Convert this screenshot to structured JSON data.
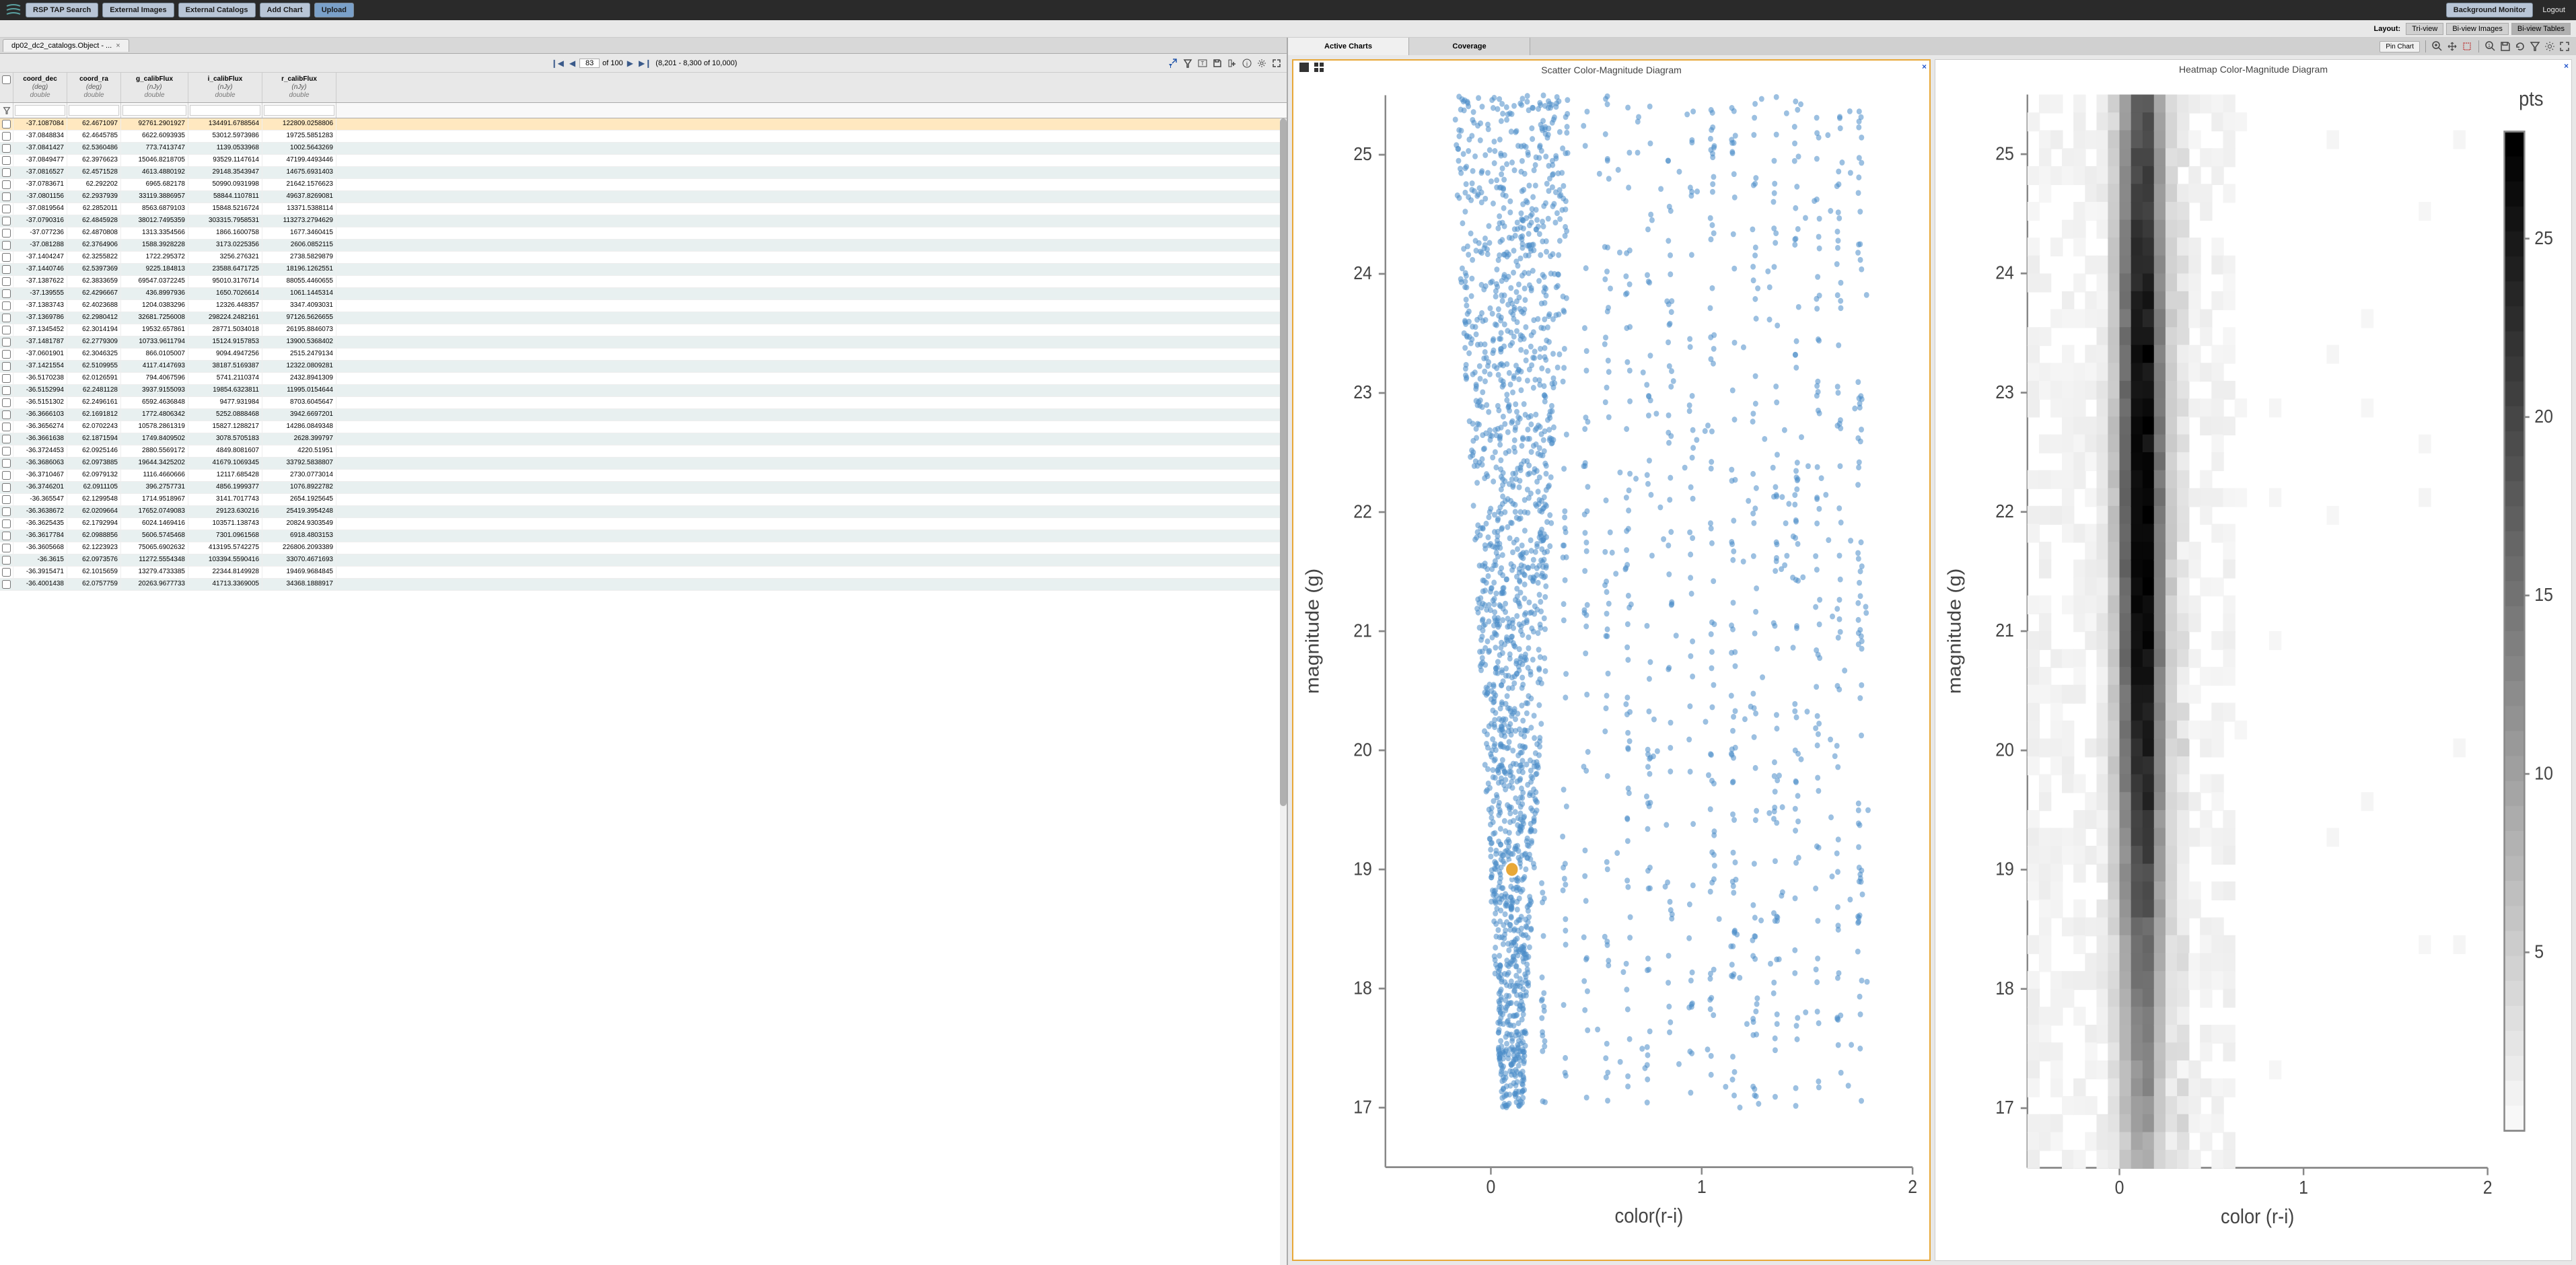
{
  "topbar": {
    "buttons": [
      "RSP TAP Search",
      "External Images",
      "External Catalogs",
      "Add Chart",
      "Upload"
    ],
    "bg_monitor": "Background Monitor",
    "logout": "Logout"
  },
  "layout": {
    "label": "Layout:",
    "options": [
      "Tri-view",
      "Bi-view Images",
      "Bi-view Tables"
    ],
    "active": 2
  },
  "table": {
    "tab_label": "dp02_dc2_catalogs.Object - ...",
    "pager": {
      "page": "83",
      "of_label": "of 100",
      "range": "(8,201 - 8,300 of 10,000)"
    },
    "columns": [
      {
        "name": "coord_dec",
        "unit": "(deg)",
        "type": "double"
      },
      {
        "name": "coord_ra",
        "unit": "(deg)",
        "type": "double"
      },
      {
        "name": "g_calibFlux",
        "unit": "(nJy)",
        "type": "double"
      },
      {
        "name": "i_calibFlux",
        "unit": "(nJy)",
        "type": "double"
      },
      {
        "name": "r_calibFlux",
        "unit": "(nJy)",
        "type": "double"
      }
    ],
    "rows": [
      [
        "-37.1087084",
        "62.4671097",
        "92761.2901927",
        "134491.6788564",
        "122809.0258806"
      ],
      [
        "-37.0848834",
        "62.4645785",
        "6622.6093935",
        "53012.5973986",
        "19725.5851283"
      ],
      [
        "-37.0841427",
        "62.5360486",
        "773.7413747",
        "1139.0533968",
        "1002.5643269"
      ],
      [
        "-37.0849477",
        "62.3976623",
        "15046.8218705",
        "93529.1147614",
        "47199.4493446"
      ],
      [
        "-37.0816527",
        "62.4571528",
        "4613.4880192",
        "29148.3543947",
        "14675.6931403"
      ],
      [
        "-37.0783671",
        "62.292202",
        "6965.682178",
        "50990.0931998",
        "21642.1576623"
      ],
      [
        "-37.0801156",
        "62.2937939",
        "33119.3886957",
        "58844.1107811",
        "49637.8269081"
      ],
      [
        "-37.0819564",
        "62.2852011",
        "8563.6879103",
        "15848.5216724",
        "13371.5388114"
      ],
      [
        "-37.0790316",
        "62.4845928",
        "38012.7495359",
        "303315.7958531",
        "113273.2794629"
      ],
      [
        "-37.077236",
        "62.4870808",
        "1313.3354566",
        "1866.1600758",
        "1677.3460415"
      ],
      [
        "-37.081288",
        "62.3764906",
        "1588.3928228",
        "3173.0225356",
        "2606.0852115"
      ],
      [
        "-37.1404247",
        "62.3255822",
        "1722.295372",
        "3256.276321",
        "2738.5829879"
      ],
      [
        "-37.1440746",
        "62.5397369",
        "9225.184813",
        "23588.6471725",
        "18196.1262551"
      ],
      [
        "-37.1387622",
        "62.3833659",
        "69547.0372245",
        "95010.3176714",
        "88055.4460655"
      ],
      [
        "-37.139555",
        "62.4296667",
        "436.8997936",
        "1650.7026614",
        "1061.1445314"
      ],
      [
        "-37.1383743",
        "62.4023688",
        "1204.0383296",
        "12326.448357",
        "3347.4093031"
      ],
      [
        "-37.1369786",
        "62.2980412",
        "32681.7256008",
        "298224.2482161",
        "97126.5626655"
      ],
      [
        "-37.1345452",
        "62.3014194",
        "19532.657861",
        "28771.5034018",
        "26195.8846073"
      ],
      [
        "-37.1481787",
        "62.2779309",
        "10733.9611794",
        "15124.9157853",
        "13900.5368402"
      ],
      [
        "-37.0601901",
        "62.3046325",
        "866.0105007",
        "9094.4947256",
        "2515.2479134"
      ],
      [
        "-37.1421554",
        "62.5109955",
        "4117.4147693",
        "38187.5169387",
        "12322.0809281"
      ],
      [
        "-36.5170238",
        "62.0126591",
        "794.4067596",
        "5741.2110374",
        "2432.8941309"
      ],
      [
        "-36.5152994",
        "62.2481128",
        "3937.9155093",
        "19854.6323811",
        "11995.0154644"
      ],
      [
        "-36.5151302",
        "62.2496161",
        "6592.4636848",
        "9477.931984",
        "8703.6045647"
      ],
      [
        "-36.3666103",
        "62.1691812",
        "1772.4806342",
        "5252.0888468",
        "3942.6697201"
      ],
      [
        "-36.3656274",
        "62.0702243",
        "10578.2861319",
        "15827.1288217",
        "14286.0849348"
      ],
      [
        "-36.3661638",
        "62.1871594",
        "1749.8409502",
        "3078.5705183",
        "2628.399797"
      ],
      [
        "-36.3724453",
        "62.0925146",
        "2880.5569172",
        "4849.8081607",
        "4220.51951"
      ],
      [
        "-36.3686063",
        "62.0973885",
        "19644.3425202",
        "41679.1069345",
        "33792.5838807"
      ],
      [
        "-36.3710467",
        "62.0979132",
        "1116.4660666",
        "12117.685428",
        "2730.0773014"
      ],
      [
        "-36.3746201",
        "62.0911105",
        "396.2757731",
        "4856.1999377",
        "1076.8922782"
      ],
      [
        "-36.365547",
        "62.1299548",
        "1714.9518967",
        "3141.7017743",
        "2654.1925645"
      ],
      [
        "-36.3638672",
        "62.0209664",
        "17652.0749083",
        "29123.630216",
        "25419.3954248"
      ],
      [
        "-36.3625435",
        "62.1792994",
        "6024.1469416",
        "103571.138743",
        "20824.9303549"
      ],
      [
        "-36.3617784",
        "62.0988856",
        "5606.5745468",
        "7301.0961568",
        "6918.4803153"
      ],
      [
        "-36.3605668",
        "62.1223923",
        "75065.6902632",
        "413195.5742275",
        "226806.2093389"
      ],
      [
        "-36.3615",
        "62.0973576",
        "11272.5554348",
        "103394.5590416",
        "33070.4671693"
      ],
      [
        "-36.3915471",
        "62.1015659",
        "13279.4733385",
        "22344.8149928",
        "19469.9684845"
      ],
      [
        "-36.4001438",
        "62.0757759",
        "20263.9677733",
        "41713.3369005",
        "34368.1888917"
      ]
    ]
  },
  "right_tabs": {
    "items": [
      "Active Charts",
      "Coverage"
    ],
    "active": 0,
    "pin": "Pin Chart"
  },
  "chart_data": [
    {
      "type": "scatter",
      "title": "Scatter Color-Magnitude Diagram",
      "xlabel": "color(r-i)",
      "ylabel": "magnitude (g)",
      "xlim": [
        -0.5,
        2
      ],
      "ylim": [
        25.5,
        16.5
      ],
      "xticks": [
        0,
        1,
        2
      ],
      "yticks": [
        17,
        18,
        19,
        20,
        21,
        22,
        23,
        24,
        25
      ],
      "highlight": {
        "x": 0.1,
        "y": 19.0
      }
    },
    {
      "type": "heatmap",
      "title": "Heatmap Color-Magnitude Diagram",
      "xlabel": "color (r-i)",
      "ylabel": "magnitude (g)",
      "xlim": [
        -0.5,
        2
      ],
      "ylim": [
        25.5,
        16.5
      ],
      "xticks": [
        0,
        1,
        2
      ],
      "yticks": [
        17,
        18,
        19,
        20,
        21,
        22,
        23,
        24,
        25
      ],
      "colorbar": {
        "label": "pts",
        "ticks": [
          5,
          10,
          15,
          20,
          25
        ]
      }
    }
  ]
}
